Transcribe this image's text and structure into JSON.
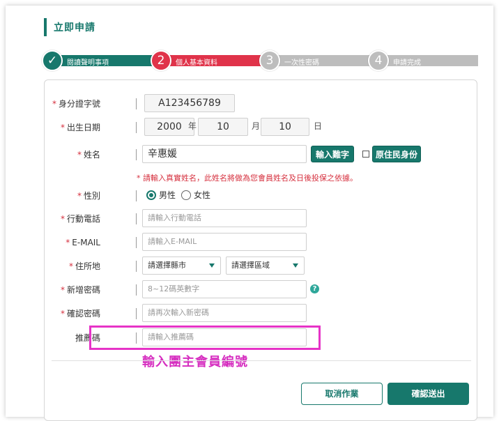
{
  "title": "立即申請",
  "steps": [
    {
      "label": "閱讀聲明事項",
      "number": "✓",
      "state": "done"
    },
    {
      "label": "個人基本資料",
      "number": "2",
      "state": "current"
    },
    {
      "label": "一次性密碼",
      "number": "3",
      "state": "todo"
    },
    {
      "label": "申請完成",
      "number": "4",
      "state": "todo"
    }
  ],
  "colors": {
    "primary": "#17786c",
    "current": "#e0334a",
    "todo": "#bdbdbd",
    "highlight": "#e633c7"
  },
  "form": {
    "required_mark": "*",
    "id_label": "身分證字號",
    "id_value": "A123456789",
    "birth_label": "出生日期",
    "birth_year": "2000",
    "year_unit": "年",
    "birth_month": "10",
    "month_unit": "月",
    "birth_day": "10",
    "day_unit": "日",
    "name_label": "姓名",
    "name_value": "辛惠媛",
    "rare_char_button": "輸入難字",
    "aboriginal_label": "原住民身份",
    "name_note": "* 請輸入真實姓名，此姓名將做為您會員姓名及日後投保之依據。",
    "gender_label": "性別",
    "gender_male": "男性",
    "gender_female": "女性",
    "gender_selected": "男性",
    "mobile_label": "行動電話",
    "mobile_placeholder": "請輸入行動電話",
    "email_label": "E-MAIL",
    "email_placeholder": "請輸入E-MAIL",
    "address_label": "住所地",
    "county_placeholder": "請選擇縣市",
    "district_placeholder": "請選擇區域",
    "password_label": "新增密碼",
    "password_placeholder": "8~12碼英數字",
    "help_icon": "?",
    "confirm_label": "確認密碼",
    "confirm_placeholder": "請再次輸入新密碼",
    "referral_label": "推薦碼",
    "referral_placeholder": "請輸入推薦碼"
  },
  "annotation": "輸入團主會員編號",
  "actions": {
    "cancel": "取消作業",
    "submit": "確認送出"
  }
}
